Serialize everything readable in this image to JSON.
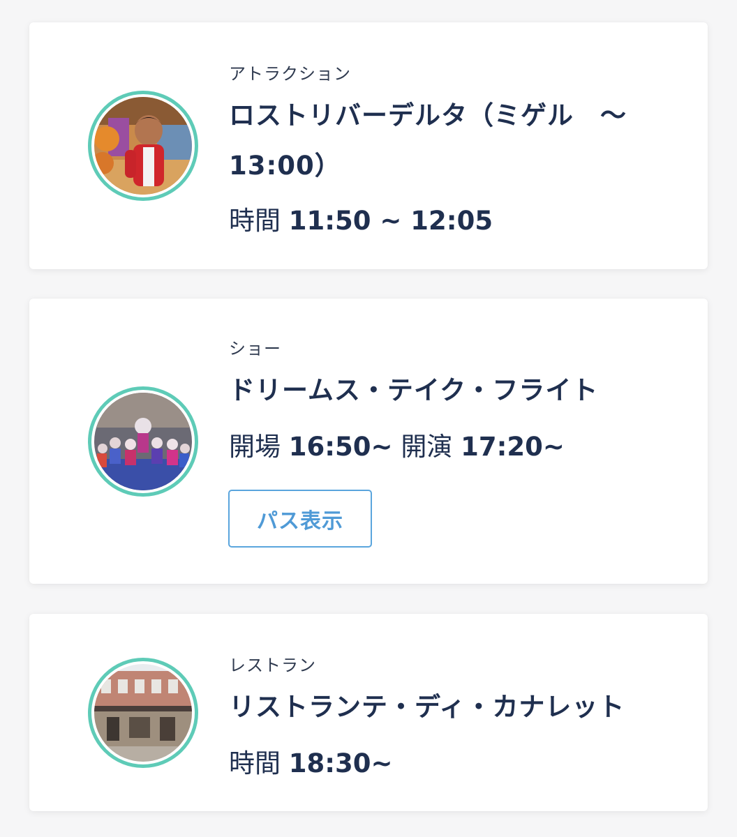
{
  "items": [
    {
      "category": "アトラクション",
      "title_line1": "ロストリバーデルタ（ミゲル　～",
      "title_line2": "13:00）",
      "time_label": "時間",
      "time_value": "11:50 ~ 12:05",
      "thumb_icon": "character-photo"
    },
    {
      "category": "ショー",
      "title": "ドリームス・テイク・フライト",
      "open_label": "開場",
      "open_value": "16:50~",
      "start_label": "開演",
      "start_value": "17:20~",
      "pass_button": "パス表示",
      "thumb_icon": "show-photo"
    },
    {
      "category": "レストラン",
      "title": "リストランテ・ディ・カナレット",
      "time_label": "時間",
      "time_value": "18:30~",
      "thumb_icon": "restaurant-photo"
    }
  ],
  "colors": {
    "accent_ring": "#5ecbb7",
    "title_text": "#1f2f4f",
    "button_border": "#5aa5dd",
    "button_text": "#4f9ad6"
  }
}
